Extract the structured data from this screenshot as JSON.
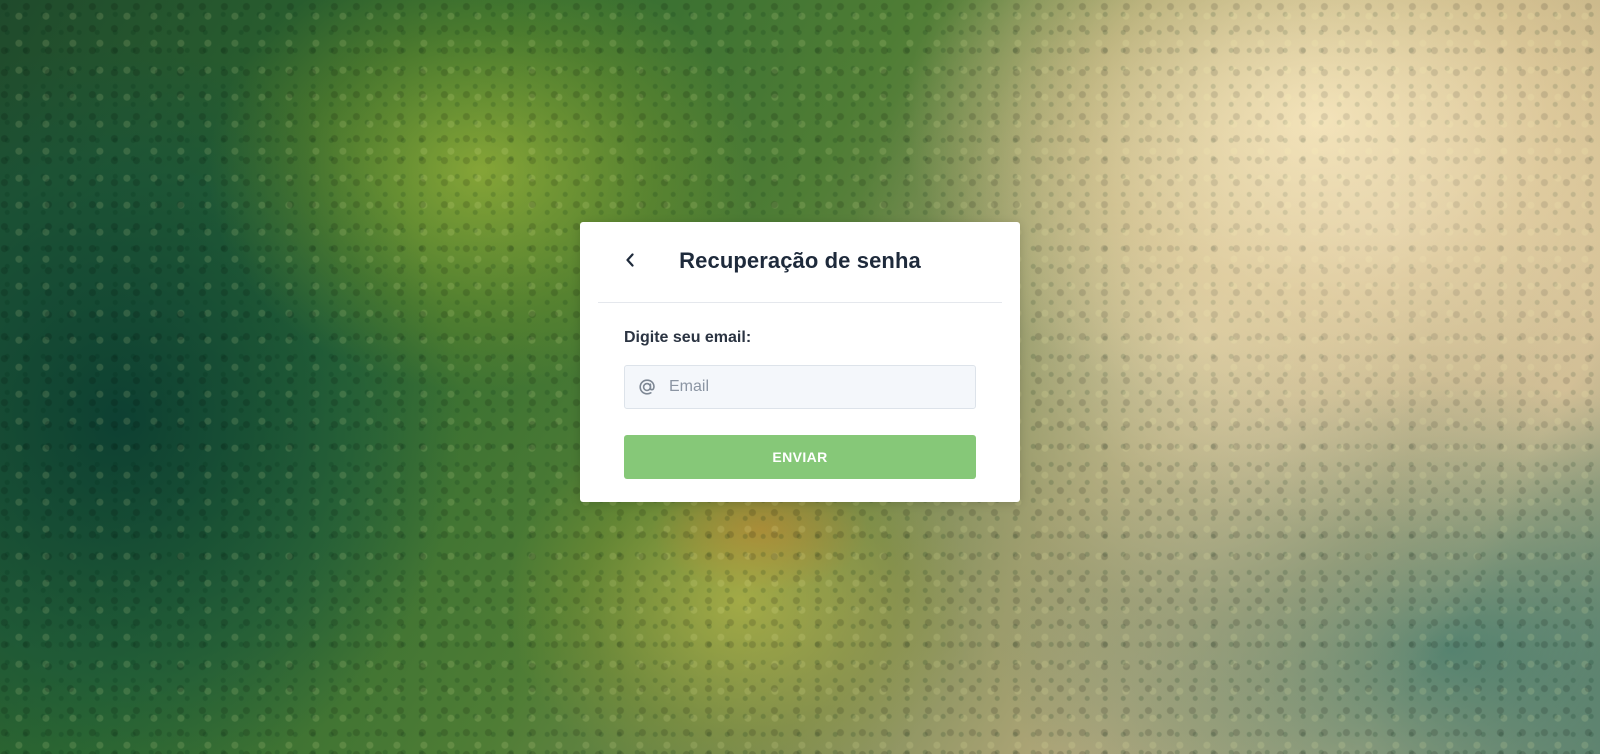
{
  "page": {
    "background_description_icon": "forest-aerial-background"
  },
  "card": {
    "title": "Recuperação de senha",
    "back_icon": "chevron-left-icon"
  },
  "form": {
    "email_label": "Digite seu email:",
    "email_placeholder": "Email",
    "email_value": "",
    "email_icon": "at-sign-icon",
    "submit_label": "ENVIAR"
  },
  "colors": {
    "button_bg": "#86c878",
    "title_text": "#1e2a3b",
    "input_bg": "#f4f7fb"
  }
}
